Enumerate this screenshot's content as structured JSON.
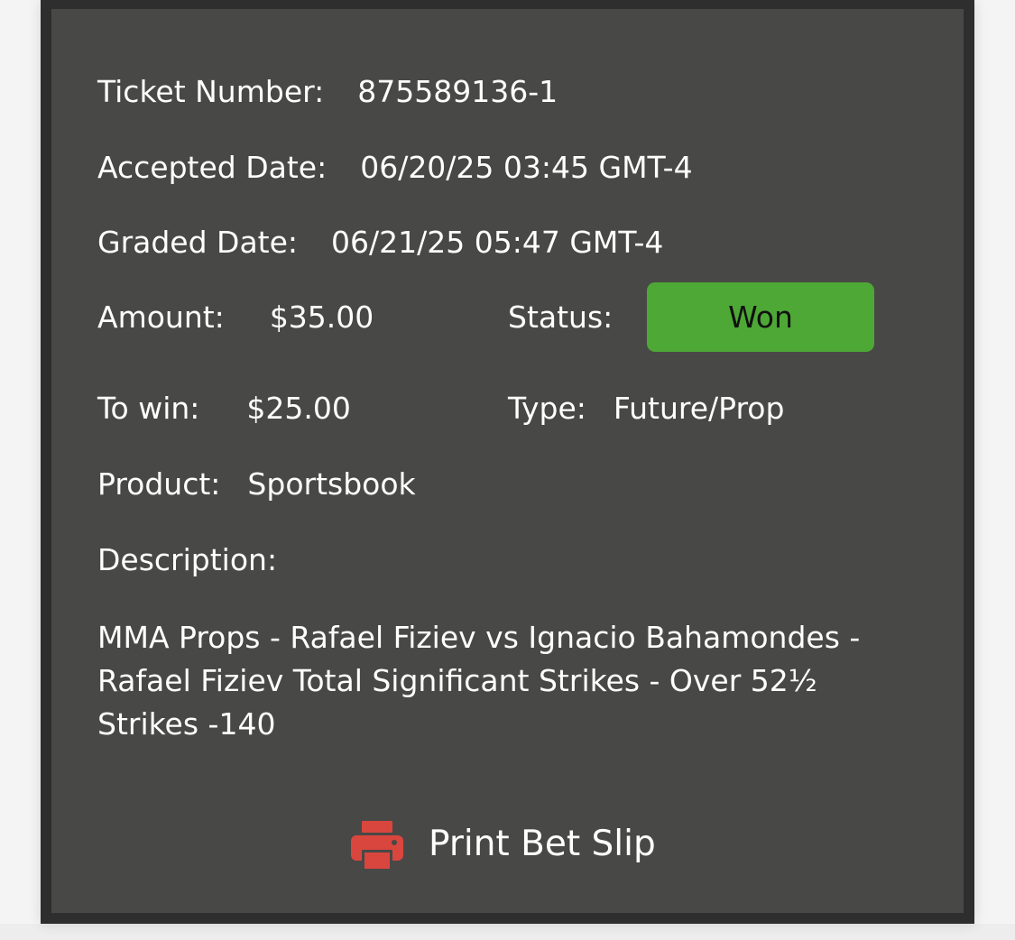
{
  "ticket": {
    "ticket_number_label": "Ticket Number:",
    "ticket_number_value": "875589136-1",
    "accepted_date_label": "Accepted Date:",
    "accepted_date_value": "06/20/25 03:45 GMT-4",
    "graded_date_label": "Graded Date:",
    "graded_date_value": "06/21/25 05:47 GMT-4",
    "amount_label": "Amount:",
    "amount_value": "$35.00",
    "status_label": "Status:",
    "status_value": "Won",
    "to_win_label": "To win:",
    "to_win_value": "$25.00",
    "type_label": "Type:",
    "type_value": "Future/Prop",
    "product_label": "Product:",
    "product_value": "Sportsbook",
    "description_label": "Description:",
    "description_value": "MMA Props - Rafael Fiziev vs Ignacio Bahamondes - Rafael Fiziev Total Significant Strikes - Over 52½ Strikes -140"
  },
  "actions": {
    "print_label": "Print Bet Slip",
    "print_icon": "printer-icon"
  },
  "colors": {
    "panel_background": "#484846",
    "panel_border": "#2e2e2e",
    "status_won": "#4ea835",
    "print_icon": "#d9463e"
  }
}
